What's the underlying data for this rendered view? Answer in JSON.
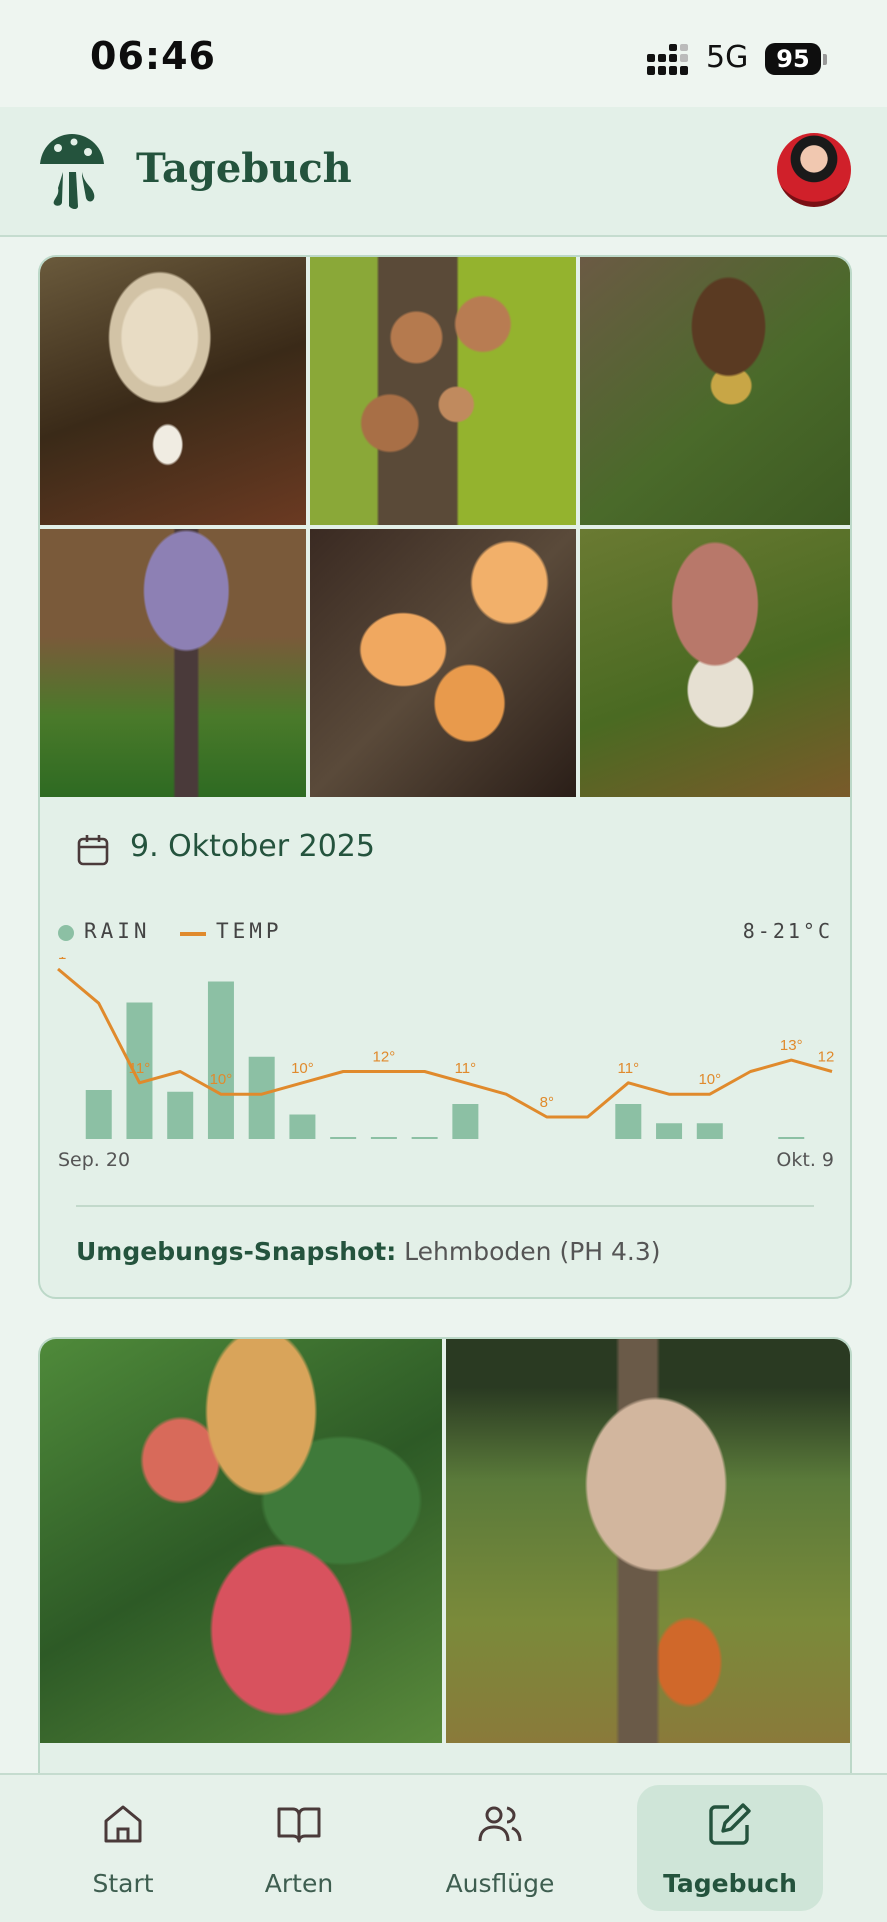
{
  "status_bar": {
    "time": "06:46",
    "network": "5G",
    "battery": "95"
  },
  "header": {
    "title": "Tagebuch"
  },
  "entries": [
    {
      "date": "9. Oktober 2025",
      "photos": [
        "mushroom-photo-1",
        "mushroom-photo-2",
        "mushroom-photo-3",
        "mushroom-photo-4",
        "mushroom-photo-5",
        "mushroom-photo-6"
      ],
      "legend_rain": "RAIN",
      "legend_temp": "TEMP",
      "temp_range": "8-21°C",
      "x_start": "Sep. 20",
      "x_end": "Okt. 9",
      "snapshot_label": "Umgebungs-Snapshot:",
      "snapshot_value": "Lehmboden (PH 4.3)"
    },
    {
      "photos": [
        "mushroom-photo-7",
        "mushroom-photo-8"
      ]
    }
  ],
  "chart_data": {
    "type": "bar",
    "categories": [
      "Sep. 20",
      "",
      "",
      "",
      "",
      "",
      "",
      "",
      "",
      "",
      "",
      "",
      "",
      "",
      "",
      "",
      "",
      "",
      "",
      "Okt. 9"
    ],
    "series": [
      {
        "name": "RAIN",
        "type": "bar",
        "color": "#8cc0a4",
        "values": [
          0,
          0.28,
          0.78,
          0.27,
          0.9,
          0.47,
          0.14,
          0.01,
          0.01,
          0.01,
          0.2,
          0,
          0,
          0,
          0.2,
          0.09,
          0.09,
          0,
          0.01,
          0
        ]
      },
      {
        "name": "TEMP",
        "type": "line",
        "color": "#e08a2c",
        "values": [
          21,
          18,
          11,
          12,
          10,
          10,
          11,
          12,
          12,
          12,
          11,
          10,
          8,
          8,
          11,
          10,
          10,
          12,
          13,
          12
        ],
        "labels": [
          "1°",
          "",
          "11°",
          "",
          "10°",
          "",
          "10°",
          "",
          "12°",
          "",
          "11°",
          "",
          "8°",
          "",
          "11°",
          "",
          "10°",
          "",
          "13°",
          "12"
        ]
      }
    ],
    "legend": "top-left",
    "ylim_temp": [
      8,
      21
    ]
  },
  "nav": {
    "items": [
      {
        "label": "Start",
        "icon": "home-icon"
      },
      {
        "label": "Arten",
        "icon": "book-icon"
      },
      {
        "label": "Ausflüge",
        "icon": "users-icon"
      },
      {
        "label": "Tagebuch",
        "icon": "edit-icon"
      }
    ]
  },
  "colors": {
    "accent": "#24533d",
    "rain": "#8cc0a4",
    "temp": "#e08a2c",
    "background": "#ecf4ef"
  }
}
